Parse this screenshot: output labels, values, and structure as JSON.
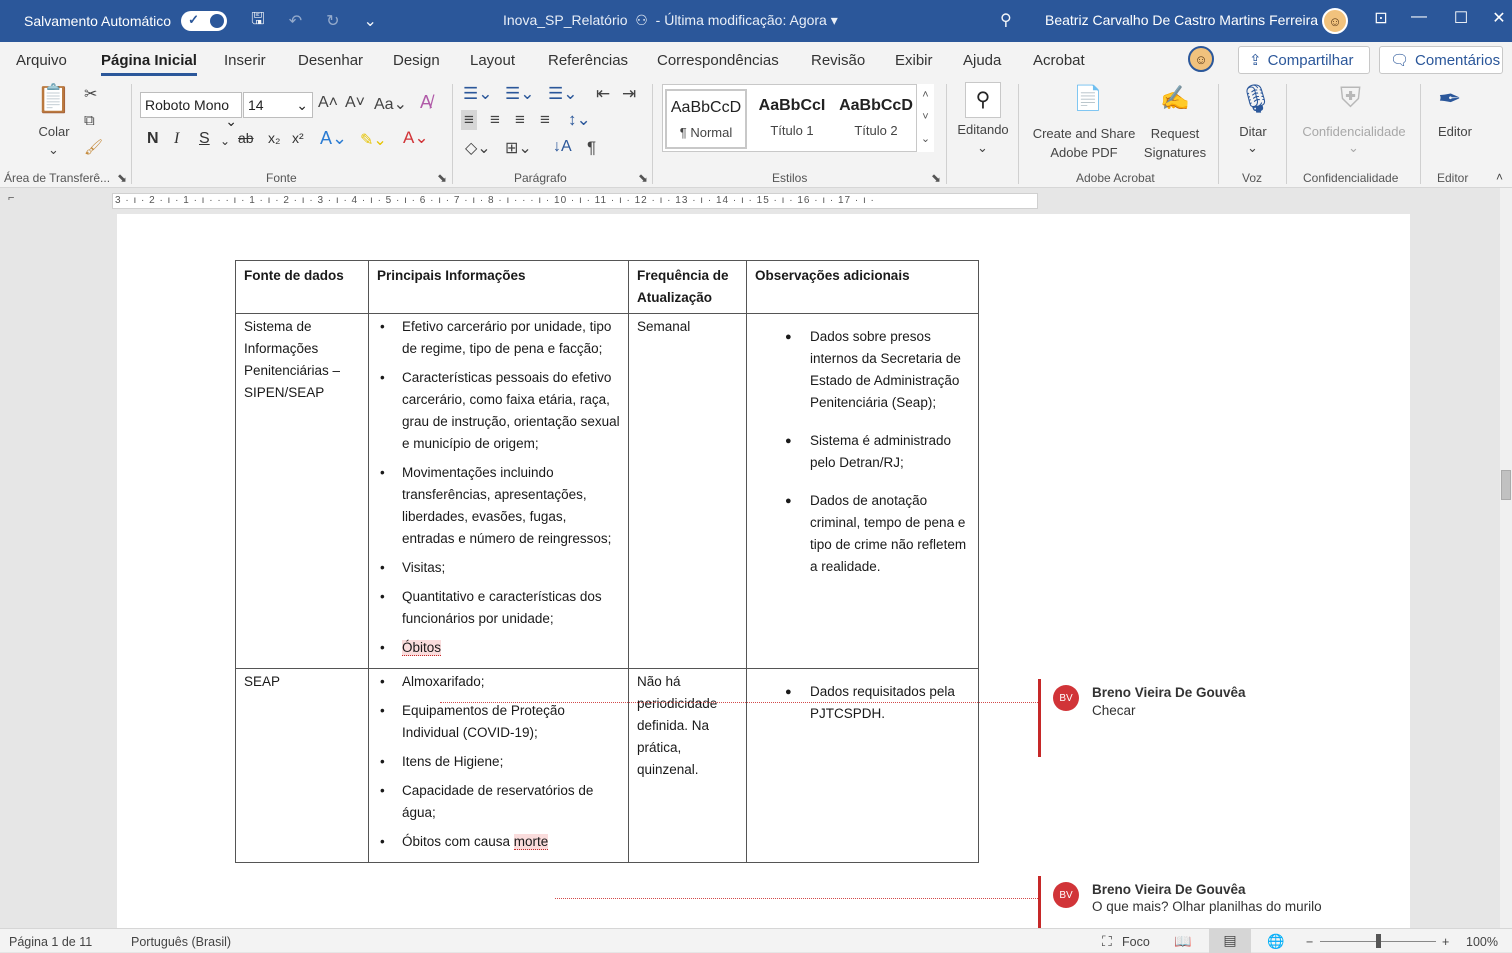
{
  "titlebar": {
    "autosave_label": "Salvamento Automático",
    "doc_title": "Inova_SP_Relatório",
    "modified": "-  Última modificação: Agora",
    "user_name": "Beatriz Carvalho De Castro Martins Ferreira"
  },
  "menu": {
    "items": [
      "Arquivo",
      "Página Inicial",
      "Inserir",
      "Desenhar",
      "Design",
      "Layout",
      "Referências",
      "Correspondências",
      "Revisão",
      "Exibir",
      "Ajuda",
      "Acrobat"
    ],
    "share": "Compartilhar",
    "comments": "Comentários"
  },
  "ribbon": {
    "paste": "Colar",
    "clipboard_group": "Área de Transferê...",
    "font_name": "Roboto Mono",
    "font_size": "14",
    "font_group": "Fonte",
    "paragraph_group": "Parágrafo",
    "styles": [
      {
        "sample": "AaBbCcD",
        "name": "¶ Normal"
      },
      {
        "sample": "AaBbCcI",
        "name": "Título 1"
      },
      {
        "sample": "AaBbCcD",
        "name": "Título 2"
      }
    ],
    "styles_group": "Estilos",
    "editing": "Editando",
    "create_pdf": "Create and Share Adobe PDF",
    "request_sig": "Request Signatures",
    "acrobat_group": "Adobe Acrobat",
    "dictate": "Ditar",
    "voice_group": "Voz",
    "confidentiality": "Confidencialidade",
    "confidentiality_group": "Confidencialidade",
    "editor": "Editor",
    "editor_group": "Editor"
  },
  "ruler": "3 · ı · 2 · ı · 1 · ı · · · ı · 1 · ı · 2 · ı · 3 · ı · 4 · ı · 5 · ı · 6 · ı · 7 · ı · 8 · ı · · · ı · 10 · ı · 11 · ı · 12 · ı · 13 · ı · 14 · ı · 15 · ı · 16 · ı · 17 · ı ·",
  "table": {
    "headers": [
      "Fonte de dados",
      "Principais Informações",
      "Frequência de Atualização",
      "Observações adicionais"
    ],
    "row1": {
      "source": "Sistema de Informações Penitenciárias – SIPEN/SEAP",
      "info": [
        "Efetivo carcerário por unidade, tipo de regime, tipo de pena e facção;",
        "Características pessoais do efetivo carcerário, como faixa etária, raça, grau de instrução, orientação sexual e município de origem;",
        "Movimentações incluindo transferências, apresentações, liberdades, evasões, fugas, entradas e número de reingressos;",
        "Visitas;",
        "Quantitativo e características dos funcionários por unidade;"
      ],
      "info_last": "Óbitos",
      "frequency": "Semanal",
      "notes": [
        "Dados sobre presos internos da Secretaria de Estado de Administração Penitenciária (Seap);",
        "Sistema é administrado pelo Detran/RJ;",
        "Dados de anotação criminal, tempo de pena e tipo de crime não refletem a realidade."
      ]
    },
    "row2": {
      "source": "SEAP",
      "info": [
        "Almoxarifado;",
        "Equipamentos de Proteção Individual (COVID-19);",
        "Itens de Higiene;",
        "Capacidade de reservatórios de água;"
      ],
      "info_last_prefix": "Óbitos com causa ",
      "info_last_hl": "morte",
      "frequency": "Não há periodicidade definida. Na prática, quinzenal.",
      "notes": [
        "Dados requisitados pela PJTCSPDH."
      ]
    }
  },
  "comments": [
    {
      "initials": "BV",
      "author": "Breno Vieira De Gouvêa",
      "text": "Checar"
    },
    {
      "initials": "BV",
      "author": "Breno Vieira De Gouvêa",
      "text": "O que mais? Olhar planilhas do murilo"
    }
  ],
  "status": {
    "page": "Página 1 de 11",
    "language": "Português (Brasil)",
    "focus": "Foco",
    "zoom": "100%"
  }
}
